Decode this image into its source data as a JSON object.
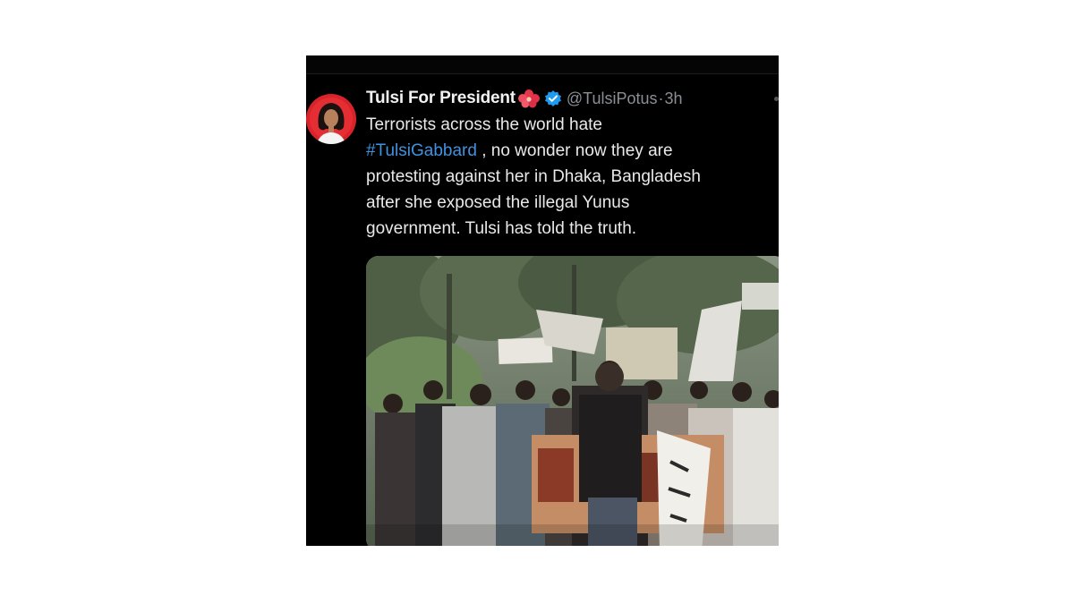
{
  "tweet": {
    "display_name": "Tulsi For President",
    "handle": "@TulsiPotus",
    "separator": "·",
    "time": "3h",
    "text_line_1": "Terrorists across the world hate",
    "hashtag": "#TulsiGabbard",
    "text_line_2_rest": " , no wonder now they are",
    "text_line_3": "protesting against her in Dhaka, Bangladesh",
    "text_line_4": "after she exposed the illegal Yunus",
    "text_line_5": "government. Tulsi has told the truth."
  },
  "icons": {
    "name_emoji": "hibiscus-flower-icon",
    "badge": "verified-badge-icon"
  },
  "colors": {
    "background": "#000000",
    "name_text": "#f2f2f2",
    "body_text": "#e9e9e9",
    "meta_text": "#8b8f94",
    "hashtag": "#3f92e0",
    "verified_badge": "#1d9bf0",
    "avatar_ring": "#e0242a"
  }
}
